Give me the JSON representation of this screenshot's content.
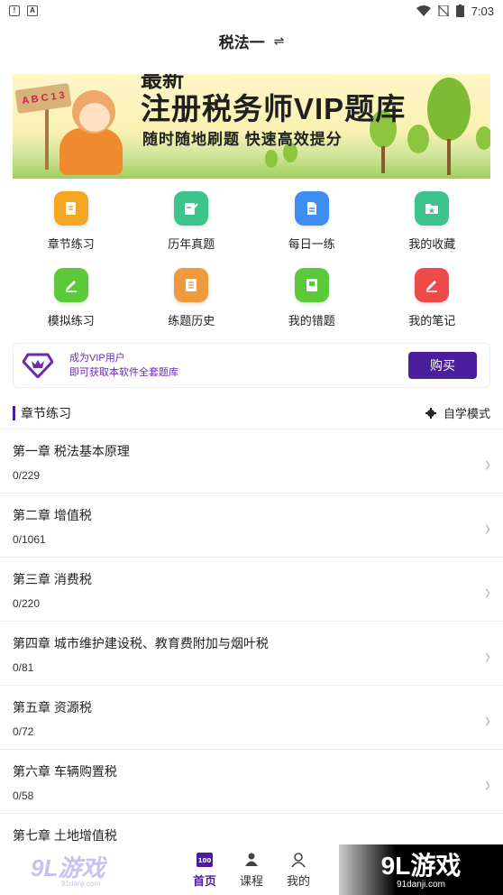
{
  "status": {
    "time": "7:03"
  },
  "header": {
    "title": "税法一",
    "switch_icon": "swap-icon"
  },
  "banner": {
    "title_top": "最新",
    "title": "注册税务师VIP题库",
    "subtitle": "随时随地刷题 快速高效提分",
    "sign_text": "A B C 1 3"
  },
  "grid": [
    {
      "label": "章节练习",
      "icon": "document-icon",
      "color": "#f5a623"
    },
    {
      "label": "历年真题",
      "icon": "edit-icon",
      "color": "#3cc48c"
    },
    {
      "label": "每日一练",
      "icon": "file-icon",
      "color": "#3d8ef0"
    },
    {
      "label": "我的收藏",
      "icon": "star-folder-icon",
      "color": "#3cc48c"
    },
    {
      "label": "模拟练习",
      "icon": "pencil-icon",
      "color": "#5cc93a"
    },
    {
      "label": "练题历史",
      "icon": "history-icon",
      "color": "#f09a3e"
    },
    {
      "label": "我的错题",
      "icon": "book-icon",
      "color": "#5cc93a"
    },
    {
      "label": "我的笔记",
      "icon": "note-icon",
      "color": "#ef4a4a"
    }
  ],
  "vip": {
    "line1": "成为VIP用户",
    "line2": "即可获取本软件全套题库",
    "button": "购买"
  },
  "section": {
    "title": "章节练习",
    "mode_label": "自学模式"
  },
  "chapters": [
    {
      "title": "第一章 税法基本原理",
      "count": "0/229"
    },
    {
      "title": "第二章 增值税",
      "count": "0/1061"
    },
    {
      "title": "第三章 消费税",
      "count": "0/220"
    },
    {
      "title": "第四章 城市维护建设税、教育费附加与烟叶税",
      "count": "0/81"
    },
    {
      "title": "第五章 资源税",
      "count": "0/72"
    },
    {
      "title": "第六章 车辆购置税",
      "count": "0/58"
    },
    {
      "title": "第七章 土地增值税",
      "count": ""
    }
  ],
  "tabs": [
    {
      "label": "首页",
      "icon": "home-100-icon",
      "active": true
    },
    {
      "label": "课程",
      "icon": "course-icon",
      "active": false
    },
    {
      "label": "我的",
      "icon": "user-icon",
      "active": false
    }
  ],
  "watermark": {
    "left_big": "9L游戏",
    "left_small": "91danji.com",
    "right_big": "9L游戏",
    "right_small": "91danji.com"
  }
}
